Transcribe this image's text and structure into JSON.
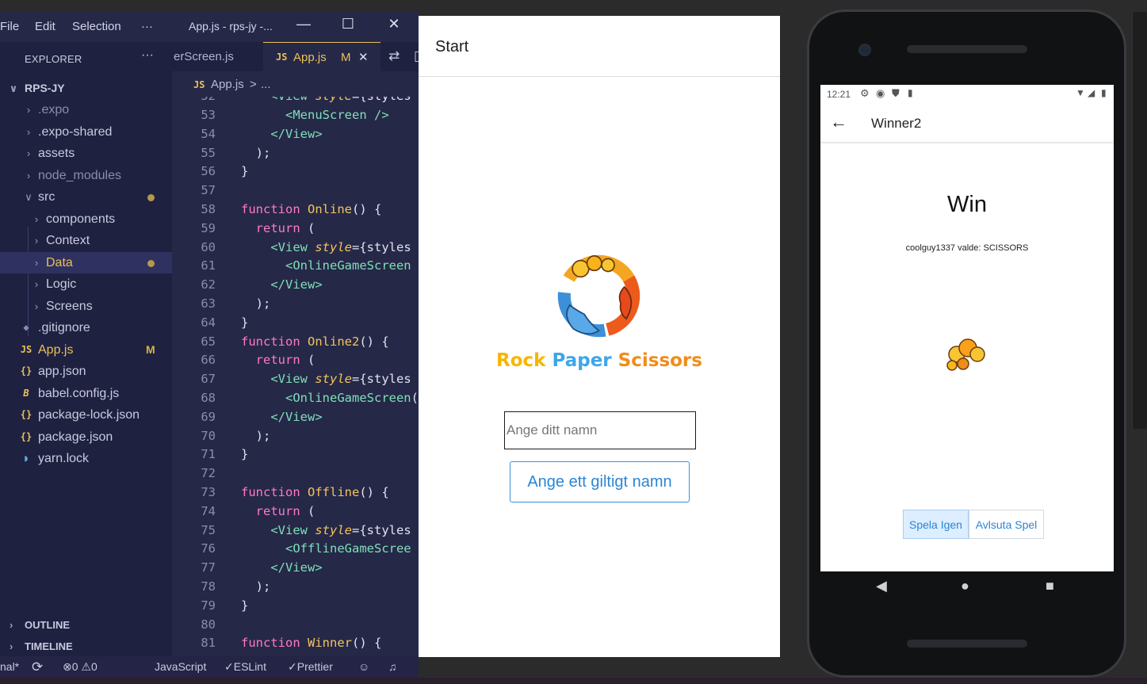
{
  "vscode": {
    "menu": [
      "File",
      "Edit",
      "Selection"
    ],
    "menu_more": "···",
    "window_title": "App.js - rps-jy -...",
    "window_buttons": {
      "minimize": "—",
      "maximize": "☐",
      "close": "✕"
    },
    "explorer": {
      "header": "EXPLORER",
      "more": "···",
      "root": "RPS-JY",
      "items": [
        {
          "label": ".expo",
          "type": "folder",
          "depth": 1
        },
        {
          "label": ".expo-shared",
          "type": "folder",
          "depth": 1
        },
        {
          "label": "assets",
          "type": "folder",
          "depth": 1
        },
        {
          "label": "node_modules",
          "type": "folder",
          "depth": 1
        },
        {
          "label": "src",
          "type": "folder-open",
          "depth": 1
        },
        {
          "label": "components",
          "type": "folder",
          "depth": 2
        },
        {
          "label": "Context",
          "type": "folder",
          "depth": 2
        },
        {
          "label": "Data",
          "type": "folder",
          "depth": 2
        },
        {
          "label": "Logic",
          "type": "folder",
          "depth": 2
        },
        {
          "label": "Screens",
          "type": "folder",
          "depth": 2
        },
        {
          "label": ".gitignore",
          "type": "file",
          "depth": 1
        },
        {
          "label": "App.js",
          "type": "js",
          "depth": 1
        },
        {
          "label": "app.json",
          "type": "json",
          "depth": 1
        },
        {
          "label": "babel.config.js",
          "type": "babel",
          "depth": 1
        },
        {
          "label": "package-lock.json",
          "type": "json",
          "depth": 1
        },
        {
          "label": "package.json",
          "type": "json",
          "depth": 1
        },
        {
          "label": "yarn.lock",
          "type": "yarn",
          "depth": 1
        }
      ],
      "modified_badge": "M",
      "outline": "OUTLINE",
      "timeline": "TIMELINE"
    },
    "tabs": [
      {
        "label": "erScreen.js",
        "active": false
      },
      {
        "label": "App.js",
        "active": true,
        "badge": "M",
        "close": "✕"
      }
    ],
    "js_tag": "JS",
    "breadcrumb": {
      "file": "App.js",
      "sep": ">",
      "rest": "..."
    },
    "code_lines": [
      {
        "n": "53",
        "text": "      <MenuScreen />"
      },
      {
        "n": "54",
        "text": "    </View>"
      },
      {
        "n": "55",
        "text": "  );"
      },
      {
        "n": "56",
        "text": "}"
      },
      {
        "n": "57",
        "text": ""
      },
      {
        "n": "58",
        "text": "function Online() {"
      },
      {
        "n": "59",
        "text": "  return ("
      },
      {
        "n": "60",
        "text": "    <View style={styles"
      },
      {
        "n": "61",
        "text": "      <OnlineGameScreen"
      },
      {
        "n": "62",
        "text": "    </View>"
      },
      {
        "n": "63",
        "text": "  );"
      },
      {
        "n": "64",
        "text": "}"
      },
      {
        "n": "65",
        "text": "function Online2() {"
      },
      {
        "n": "66",
        "text": "  return ("
      },
      {
        "n": "67",
        "text": "    <View style={styles"
      },
      {
        "n": "68",
        "text": "      <OnlineGameScreen("
      },
      {
        "n": "69",
        "text": "    </View>"
      },
      {
        "n": "70",
        "text": "  );"
      },
      {
        "n": "71",
        "text": "}"
      },
      {
        "n": "72",
        "text": ""
      },
      {
        "n": "73",
        "text": "function Offline() {"
      },
      {
        "n": "74",
        "text": "  return ("
      },
      {
        "n": "75",
        "text": "    <View style={styles"
      },
      {
        "n": "76",
        "text": "      <OfflineGameScree"
      },
      {
        "n": "77",
        "text": "    </View>"
      },
      {
        "n": "78",
        "text": "  );"
      },
      {
        "n": "79",
        "text": "}"
      },
      {
        "n": "80",
        "text": ""
      },
      {
        "n": "81",
        "text": "function Winner() {"
      }
    ],
    "status": {
      "left": "nal*",
      "sync": "⟳",
      "problems": "⊗0 ⚠0",
      "language": "JavaScript",
      "eslint": "✓ESLint",
      "prettier": "✓Prettier"
    }
  },
  "web": {
    "header_title": "Start",
    "app_title": {
      "rock": "Rock",
      "paper": "Paper",
      "scissors": "Scissors"
    },
    "name_placeholder": "Ange ditt namn",
    "submit_label": "Ange ett giltigt namn",
    "colors": {
      "rock": "#f7b500",
      "paper": "#3ea6e8",
      "scissors": "#f08c1a"
    }
  },
  "phone": {
    "time": "12:21",
    "title": "Winner2",
    "back": "←",
    "result": "Win",
    "choice_text": "coolguy1337 valde: SCISSORS",
    "btn_again": "Spela Igen",
    "btn_quit": "Avlsuta Spel",
    "nav": {
      "back": "◀",
      "home": "●",
      "recent": "■"
    }
  }
}
